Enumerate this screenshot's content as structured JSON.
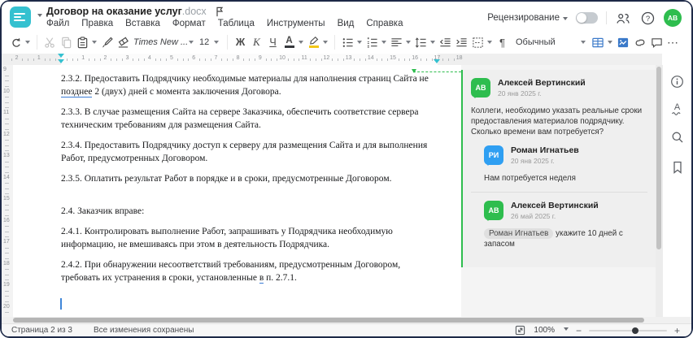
{
  "window": {
    "title": "Договор на оказание услуг",
    "ext": ".docx"
  },
  "menu": [
    "Файл",
    "Правка",
    "Вставка",
    "Формат",
    "Таблица",
    "Инструменты",
    "Вид",
    "Справка"
  ],
  "topbar": {
    "review": "Рецензирование",
    "avatar": "АВ",
    "help": "?"
  },
  "toolbar": {
    "font": "Times New ...",
    "size": "12",
    "bold": "Ж",
    "italic": "К",
    "underline": "Ч",
    "font_color": "А",
    "highlight_letter": "",
    "style": "Обычный",
    "icons": {
      "pilcrow": "¶",
      "more": "⋯"
    }
  },
  "hruler": {
    "units": [
      -2,
      -1,
      1,
      2,
      3,
      4,
      5,
      6,
      7,
      8,
      9,
      10,
      11,
      12,
      13,
      14,
      15,
      16,
      17,
      18
    ],
    "indent_left": 0,
    "indent_right": 17
  },
  "vruler": {
    "units": [
      9,
      10,
      11,
      12,
      13,
      14,
      15,
      16,
      17,
      18,
      19,
      20
    ]
  },
  "document": {
    "paragraphs": [
      {
        "parts": [
          {
            "t": "2.3.2. Предоставить Подрядчику необходимые материалы для наполнения страниц Сайта не "
          },
          {
            "t": "позднее",
            "u": true
          },
          {
            "t": " 2 (двух) дней с момента заключения Договора."
          }
        ]
      },
      {
        "parts": [
          {
            "t": "2.3.3. В случае размещения Сайта на сервере Заказчика, обеспечить соответствие сервера техническим требованиям для размещения Сайта."
          }
        ]
      },
      {
        "parts": [
          {
            "t": "2.3.4. Предоставить Подрядчику доступ к серверу для размещения Сайта и для выполнения Работ, предусмотренных Договором."
          }
        ]
      },
      {
        "parts": [
          {
            "t": "2.3.5. Оплатить результат Работ в порядке и в сроки, предусмотренные Договором."
          }
        ]
      },
      {
        "gap": true,
        "parts": [
          {
            "t": "2.4. Заказчик вправе:"
          }
        ]
      },
      {
        "parts": [
          {
            "t": "2.4.1. Контролировать выполнение Работ, запрашивать у Подрядчика необходимую информацию, не вмешиваясь при этом в деятельность Подрядчика."
          }
        ]
      },
      {
        "parts": [
          {
            "t": "2.4.2. При обнаружении несоответствий требованиям, предусмотренным Договором, требовать их устранения в сроки, установленные "
          },
          {
            "t": "в",
            "u": true
          },
          {
            "t": " п. 2.7.1."
          }
        ]
      }
    ]
  },
  "comments": [
    {
      "initials": "АВ",
      "color": "green",
      "name": "Алексей Вертинский",
      "date": "20 янв 2025 г.",
      "text": "Коллеги, необходимо указать реальные сроки предоставления материалов подрядчику. Сколько времени вам потребуется?",
      "reply": false
    },
    {
      "initials": "РИ",
      "color": "blue",
      "name": "Роман Игнатьев",
      "date": "20 янв 2025 г.",
      "text": "Нам потребуется неделя",
      "reply": true
    },
    {
      "initials": "АВ",
      "color": "green",
      "name": "Алексей Вертинский",
      "date": "26 май 2025 г.",
      "mention": "Роман Игнатьев",
      "text": "укажите 10 дней с запасом",
      "reply": true,
      "divider": true
    }
  ],
  "statusbar": {
    "page": "Страница 2 из 3",
    "saved": "Все изменения сохранены",
    "zoom": "100%"
  },
  "colors": {
    "accent_teal": "#35c1d0",
    "comment_green": "#2ebd4e",
    "reply_blue": "#2f9ff2",
    "toolbar_blue": "#3a79c9",
    "underline_blue": "#3a7bd5"
  }
}
